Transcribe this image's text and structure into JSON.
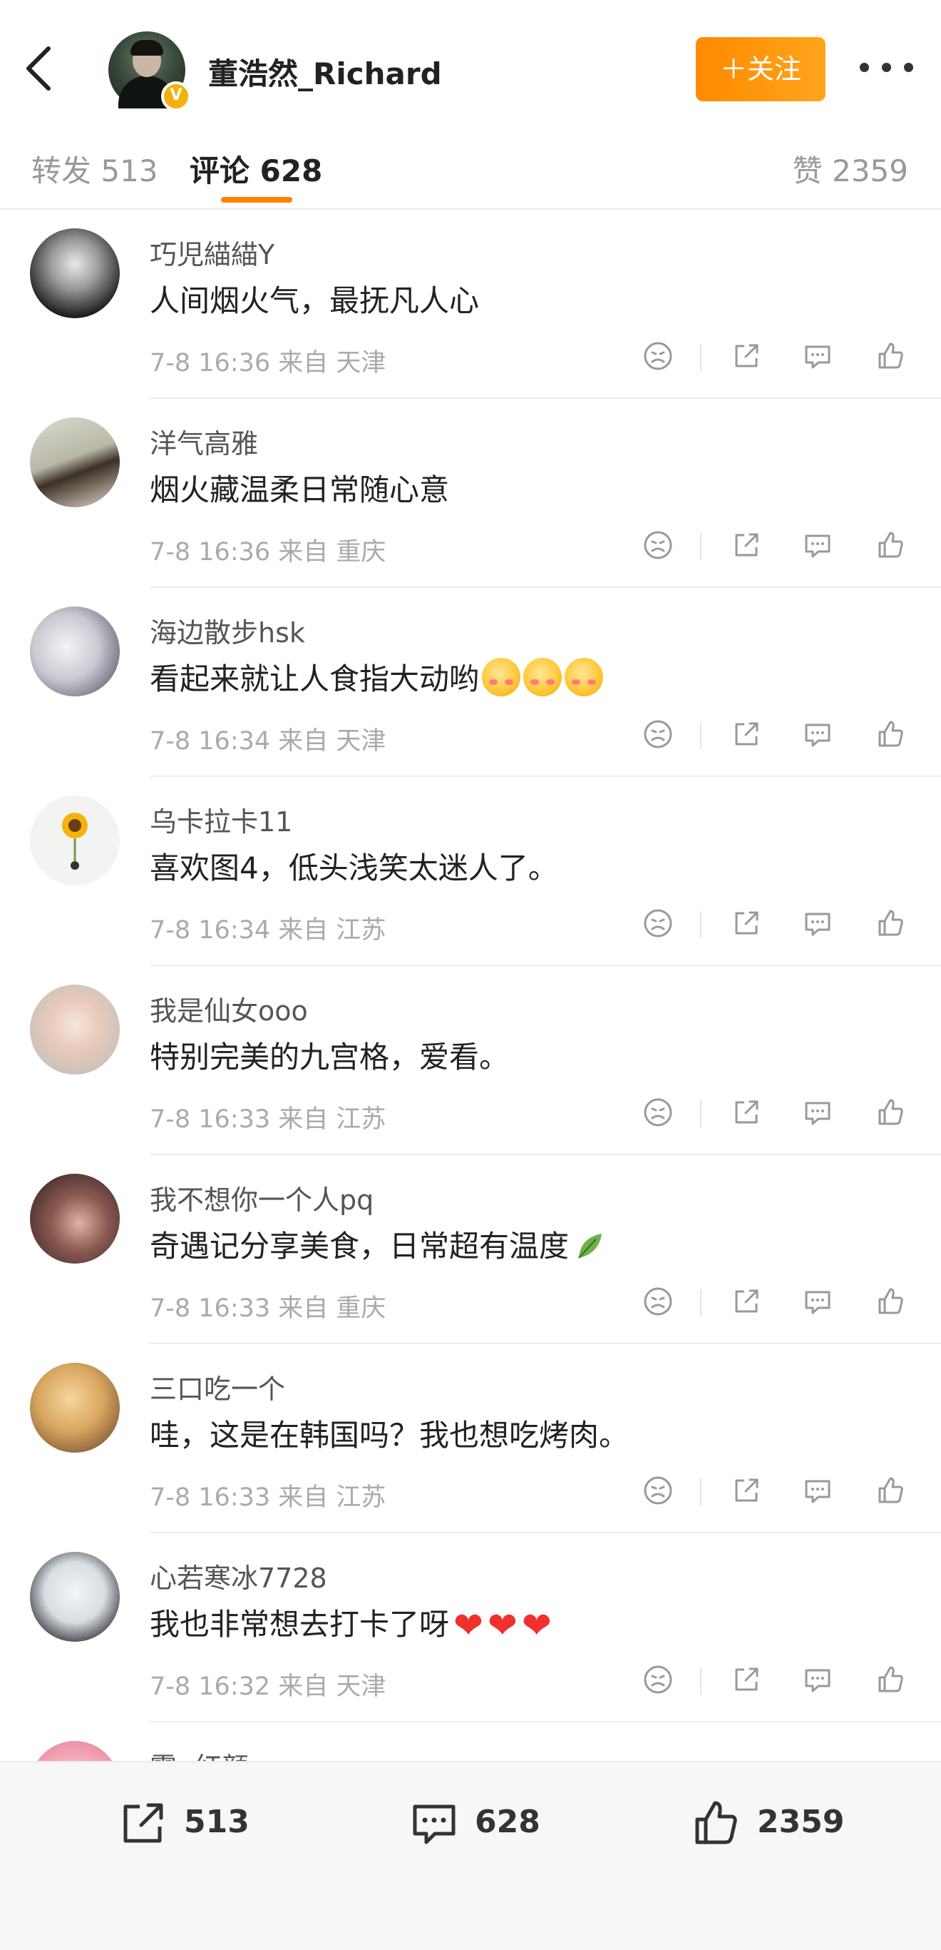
{
  "header": {
    "back_icon": "chevron-left-icon",
    "user_name": "董浩然_Richard",
    "verified_icon": "verified-badge-icon",
    "follow_label": "＋关注",
    "more_icon": "more-dots-icon",
    "accent_color": "#ff8200"
  },
  "tabs": {
    "repost_label": "转发 513",
    "comment_label": "评论 628",
    "like_label": "赞 2359"
  },
  "comments": [
    {
      "user": "巧児緢緢Y",
      "text": "人间烟火气，最抚凡人心",
      "meta": "7-8 16:36  来自 天津",
      "emoji": ""
    },
    {
      "user": "洋气高雅",
      "text": "烟火藏温柔日常随心意",
      "meta": "7-8 16:36  来自 重庆",
      "emoji": ""
    },
    {
      "user": "海边散步hsk",
      "text": "看起来就让人食指大动哟",
      "meta": "7-8 16:34  来自 天津",
      "emoji": "blush-emoji x3"
    },
    {
      "user": "乌卡拉卡11",
      "text": "喜欢图4，低头浅笑太迷人了。",
      "meta": "7-8 16:34  来自 江苏",
      "emoji": ""
    },
    {
      "user": "我是仙女ooo",
      "text": "特别完美的九宫格，爱看。",
      "meta": "7-8 16:33  来自 江苏",
      "emoji": ""
    },
    {
      "user": "我不想你一个人pq",
      "text": "奇遇记分享美食，日常超有温度",
      "meta": "7-8 16:33  来自 重庆",
      "emoji": "leaf-emoji"
    },
    {
      "user": "三口吃一个",
      "text": "哇，这是在韩国吗？我也想吃烤肉。",
      "meta": "7-8 16:33  来自 江苏",
      "emoji": ""
    },
    {
      "user": "心若寒冰7728",
      "text": "我也非常想去打卡了呀",
      "meta": "7-8 16:32  来自 天津",
      "emoji": "red-heart-emoji x3"
    },
    {
      "user": "霞α红颜",
      "text": "",
      "meta": "",
      "emoji": ""
    }
  ],
  "action_icons": [
    "dislike-icon",
    "share-icon",
    "reply-icon",
    "like-icon"
  ],
  "bottom_bar": {
    "repost_count": "513",
    "comment_count": "628",
    "like_count": "2359"
  }
}
